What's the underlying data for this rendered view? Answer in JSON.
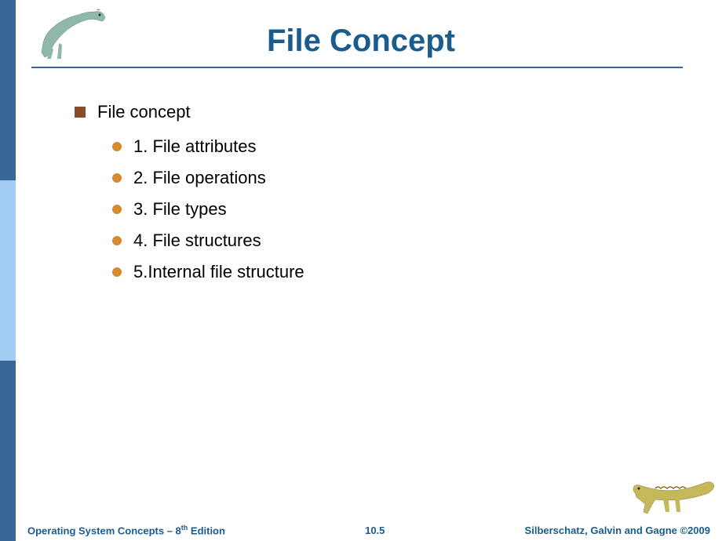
{
  "title": "File Concept",
  "main_bullet": "File concept",
  "sub_bullets": [
    "1. File attributes",
    "2. File operations",
    "3. File types",
    "4. File structures",
    "5.Internal file structure"
  ],
  "footer": {
    "left_prefix": "Operating System Concepts – 8",
    "left_super": "th",
    "left_suffix": " Edition",
    "center": "10.5",
    "right": "Silberschatz, Galvin and Gagne ©2009"
  }
}
